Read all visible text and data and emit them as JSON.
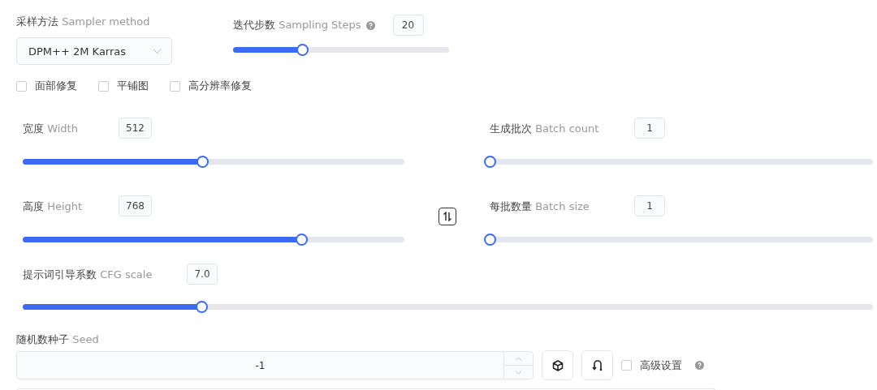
{
  "sampler": {
    "label": "采样方法",
    "label_en": "Sampler method",
    "value": "DPM++ 2M Karras"
  },
  "steps": {
    "label": "迭代步数",
    "label_en": "Sampling Steps",
    "value": "20",
    "level": 0.32
  },
  "options": [
    {
      "label": "面部修复",
      "checked": false
    },
    {
      "label": "平铺图",
      "checked": false
    },
    {
      "label": "高分辨率修复",
      "checked": false
    }
  ],
  "size_sliders": [
    {
      "label": "宽度",
      "label_en": "Width",
      "value": "512",
      "level": 0.47
    },
    {
      "label": "生成批次",
      "label_en": "Batch count",
      "value": "1",
      "level": 0
    },
    {
      "label": "高度",
      "label_en": "Height",
      "value": "768",
      "level": 0.73
    },
    {
      "label": "每批数量",
      "label_en": "Batch size",
      "value": "1",
      "level": 0
    }
  ],
  "cfg": {
    "label": "提示词引导系数",
    "label_en": "CFG scale",
    "value": "7.0",
    "level": 0.21
  },
  "seed": {
    "label": "随机数种子",
    "label_en": "Seed",
    "value": "-1"
  },
  "advanced": {
    "label": "高级设置",
    "checked": false
  }
}
